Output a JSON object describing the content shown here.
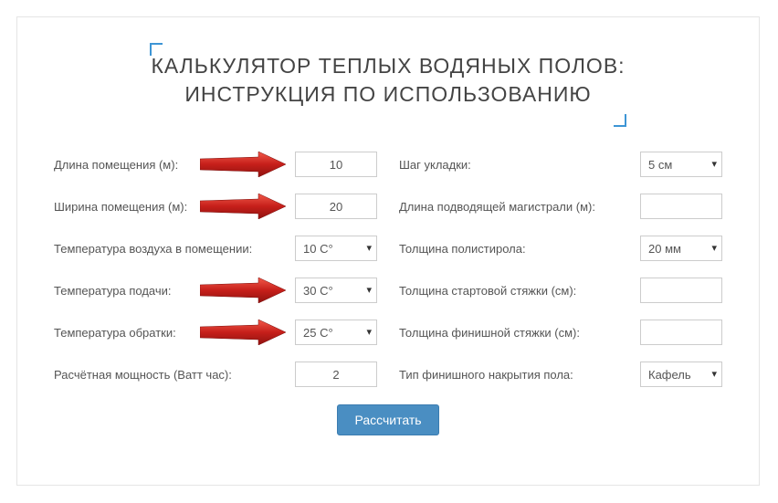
{
  "title_line1": "КАЛЬКУЛЯТОР ТЕПЛЫХ ВОДЯНЫХ ПОЛОВ:",
  "title_line2": "ИНСТРУКЦИЯ ПО ИСПОЛЬЗОВАНИЮ",
  "left": {
    "length": {
      "label": "Длина помещения (м):",
      "value": "10",
      "arrow": true
    },
    "width": {
      "label": "Ширина помещения (м):",
      "value": "20",
      "arrow": true
    },
    "air_temp": {
      "label": "Температура воздуха в помещении:",
      "value": "10 C°"
    },
    "supply_temp": {
      "label": "Температура подачи:",
      "value": "30 C°",
      "arrow": true
    },
    "return_temp": {
      "label": "Температура обратки:",
      "value": "25 C°",
      "arrow": true
    },
    "power": {
      "label": "Расчётная мощность (Ватт час):",
      "value": "2"
    }
  },
  "right": {
    "step": {
      "label": "Шаг укладки:",
      "value": "5 см"
    },
    "feed_length": {
      "label": "Длина подводящей магистрали (м):",
      "value": ""
    },
    "poly_thick": {
      "label": "Толщина полистирола:",
      "value": "20 мм"
    },
    "start_screed": {
      "label": "Толщина стартовой стяжки (см):",
      "value": ""
    },
    "finish_screed": {
      "label": "Толщина финишной стяжки (см):",
      "value": ""
    },
    "cover_type": {
      "label": "Тип финишного накрытия пола:",
      "value": "Кафель"
    }
  },
  "submit": "Рассчитать"
}
